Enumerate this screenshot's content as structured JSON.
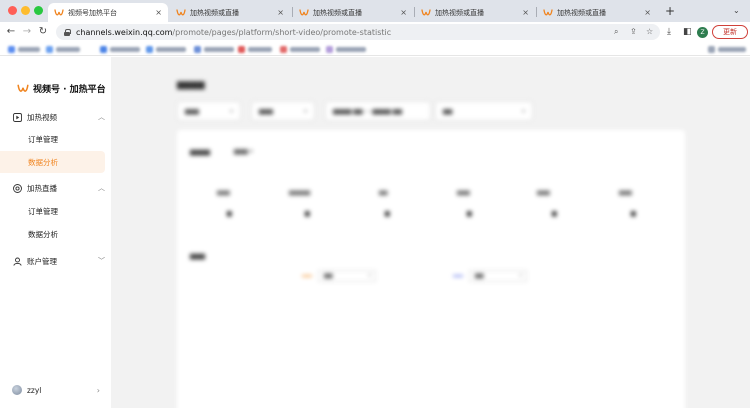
{
  "browser": {
    "tabs": [
      {
        "label": "视频号加热平台",
        "active": true
      },
      {
        "label": "加热视频或直播",
        "active": false
      },
      {
        "label": "加热视频或直播",
        "active": false
      },
      {
        "label": "加热视频或直播",
        "active": false
      },
      {
        "label": "加热视频或直播",
        "active": false
      }
    ],
    "close_glyph": "×",
    "new_tab_glyph": "+",
    "address": {
      "host": "channels.weixin.qq.com",
      "path": "/promote/pages/platform/short-video/promote-statistic"
    },
    "profile_initial": "Z",
    "update_label": "更新",
    "colors": {
      "accent": "#f0841f",
      "update": "#c2332b"
    }
  },
  "sidebar": {
    "brand": "视频号 · 加热平台",
    "groups": [
      {
        "label": "加热视频",
        "icon": "video-icon",
        "items": [
          "订单管理",
          "数据分析"
        ]
      },
      {
        "label": "加热直播",
        "icon": "live-icon",
        "items": [
          "订单管理",
          "数据分析"
        ]
      },
      {
        "label": "账户管理",
        "icon": "account-icon",
        "items": []
      }
    ],
    "active_item": "加热视频/数据分析",
    "user": {
      "name": "zzyl"
    }
  }
}
